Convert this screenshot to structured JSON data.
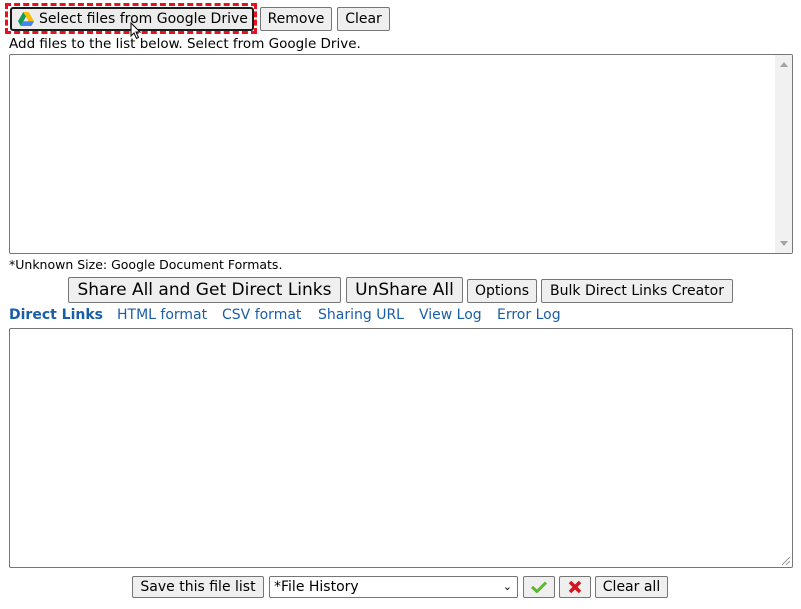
{
  "toolbar": {
    "select_drive_label": "Select files from Google Drive",
    "remove_label": "Remove",
    "clear_label": "Clear"
  },
  "instructions": "Add files to the list below. Select from Google Drive.",
  "file_list": {
    "value": ""
  },
  "note": "*Unknown Size: Google Document Formats.",
  "actions": {
    "share_all_label": "Share All and Get Direct Links",
    "unshare_all_label": "UnShare All",
    "options_label": "Options",
    "bulk_creator_label": "Bulk Direct Links Creator"
  },
  "tabs": [
    {
      "label": "Direct Links",
      "active": true
    },
    {
      "label": "HTML format",
      "active": false
    },
    {
      "label": "CSV format",
      "active": false
    },
    {
      "label": "Sharing URL",
      "active": false
    },
    {
      "label": "View Log",
      "active": false
    },
    {
      "label": "Error Log",
      "active": false
    }
  ],
  "output": {
    "value": ""
  },
  "footer": {
    "save_label": "Save this file list",
    "history_selected": "*File History",
    "confirm_icon": "checkmark-icon",
    "delete_icon": "x-icon",
    "clear_all_label": "Clear all"
  },
  "colors": {
    "highlight": "#e8101c",
    "link": "#1a5ea8",
    "confirm": "#5cb82e",
    "delete": "#d3161d"
  }
}
